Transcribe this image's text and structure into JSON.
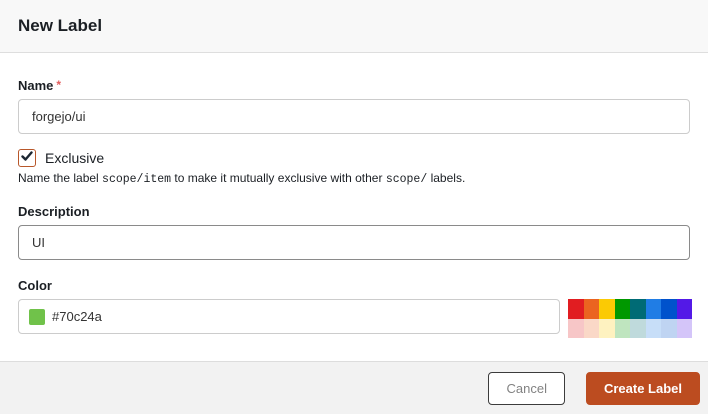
{
  "dialog": {
    "title": "New Label"
  },
  "form": {
    "name": {
      "label": "Name",
      "required_marker": "*",
      "value": "forgejo/ui"
    },
    "exclusive": {
      "label": "Exclusive",
      "checked": true,
      "help_prefix": "Name the label ",
      "help_code_1": "scope/item",
      "help_middle": " to make it mutually exclusive with other ",
      "help_code_2": "scope/",
      "help_suffix": " labels."
    },
    "description": {
      "label": "Description",
      "value": "UI"
    },
    "color": {
      "label": "Color",
      "value": "#70c24a",
      "swatch_color": "#70c24a"
    },
    "palette": [
      "#e11d21",
      "#eb6420",
      "#fbca04",
      "#009800",
      "#006b75",
      "#207de5",
      "#0052cc",
      "#5319e7",
      "#f7c6c7",
      "#fad8c7",
      "#fef2c0",
      "#bfe5bf",
      "#bfdadc",
      "#c7def8",
      "#bfd4f2",
      "#d4c5f9"
    ]
  },
  "footer": {
    "cancel_label": "Cancel",
    "submit_label": "Create Label"
  },
  "colors": {
    "accent": "#bc4c20",
    "checkbox_border": "#b8572a",
    "required": "#e25d5d",
    "header_bg": "#f8f8f8",
    "footer_bg": "#f2f2f2"
  }
}
